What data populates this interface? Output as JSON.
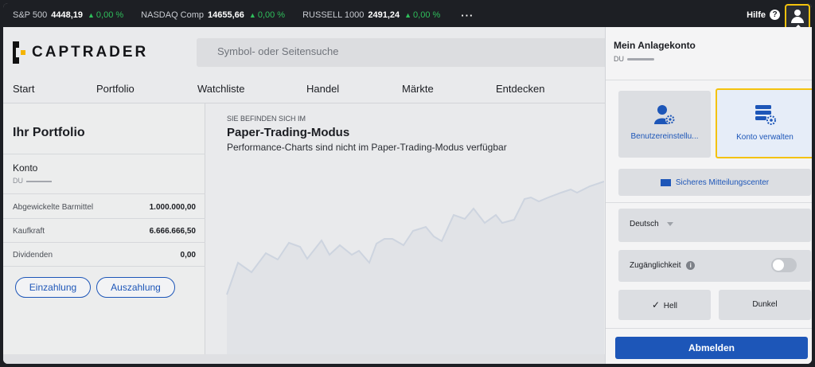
{
  "ticker": [
    {
      "name": "S&P 500",
      "value": "4448,19",
      "change": "0,00 %"
    },
    {
      "name": "NASDAQ Comp",
      "value": "14655,66",
      "change": "0,00 %"
    },
    {
      "name": "RUSSELL 1000",
      "value": "2491,24",
      "change": "0,00 %"
    }
  ],
  "ticker_more": "···",
  "help_label": "Hilfe",
  "help_icon": "?",
  "brand": {
    "logo_text": "CAPTRADER"
  },
  "search": {
    "placeholder": "Symbol- oder Seitensuche"
  },
  "nav": [
    "Start",
    "Portfolio",
    "Watchliste",
    "Handel",
    "Märkte",
    "Entdecken"
  ],
  "portfolio": {
    "title": "Ihr Portfolio",
    "account_label": "Konto",
    "account_id": "DU",
    "rows": [
      {
        "label": "Abgewickelte Barmittel",
        "value": "1.000.000,00"
      },
      {
        "label": "Kaufkraft",
        "value": "6.666.666,50"
      },
      {
        "label": "Dividenden",
        "value": "0,00"
      }
    ],
    "deposit_label": "Einzahlung",
    "withdraw_label": "Auszahlung"
  },
  "main": {
    "kicker": "SIE BEFINDEN SICH IM",
    "title": "Paper-Trading-Modus",
    "subtitle": "Performance-Charts sind nicht im Paper-Trading-Modus verfügbar"
  },
  "account_menu": {
    "title": "Mein Anlagekonto",
    "account_id": "DU",
    "tiles": [
      {
        "label": "Benutzereinstellu...",
        "icon": "user-settings-icon"
      },
      {
        "label": "Konto verwalten",
        "icon": "account-settings-icon"
      }
    ],
    "message_center": "Sicheres Mitteilungscenter",
    "language": "Deutsch",
    "accessibility_label": "Zugänglichkeit",
    "accessibility_enabled": false,
    "theme_light": "Hell",
    "theme_dark": "Dunkel",
    "theme_selected": "Hell",
    "logout": "Abmelden"
  },
  "colors": {
    "accent": "#1d56b8",
    "positive": "#2fbf5b",
    "highlight": "#f4c20d",
    "topbar": "#1d1f24"
  }
}
